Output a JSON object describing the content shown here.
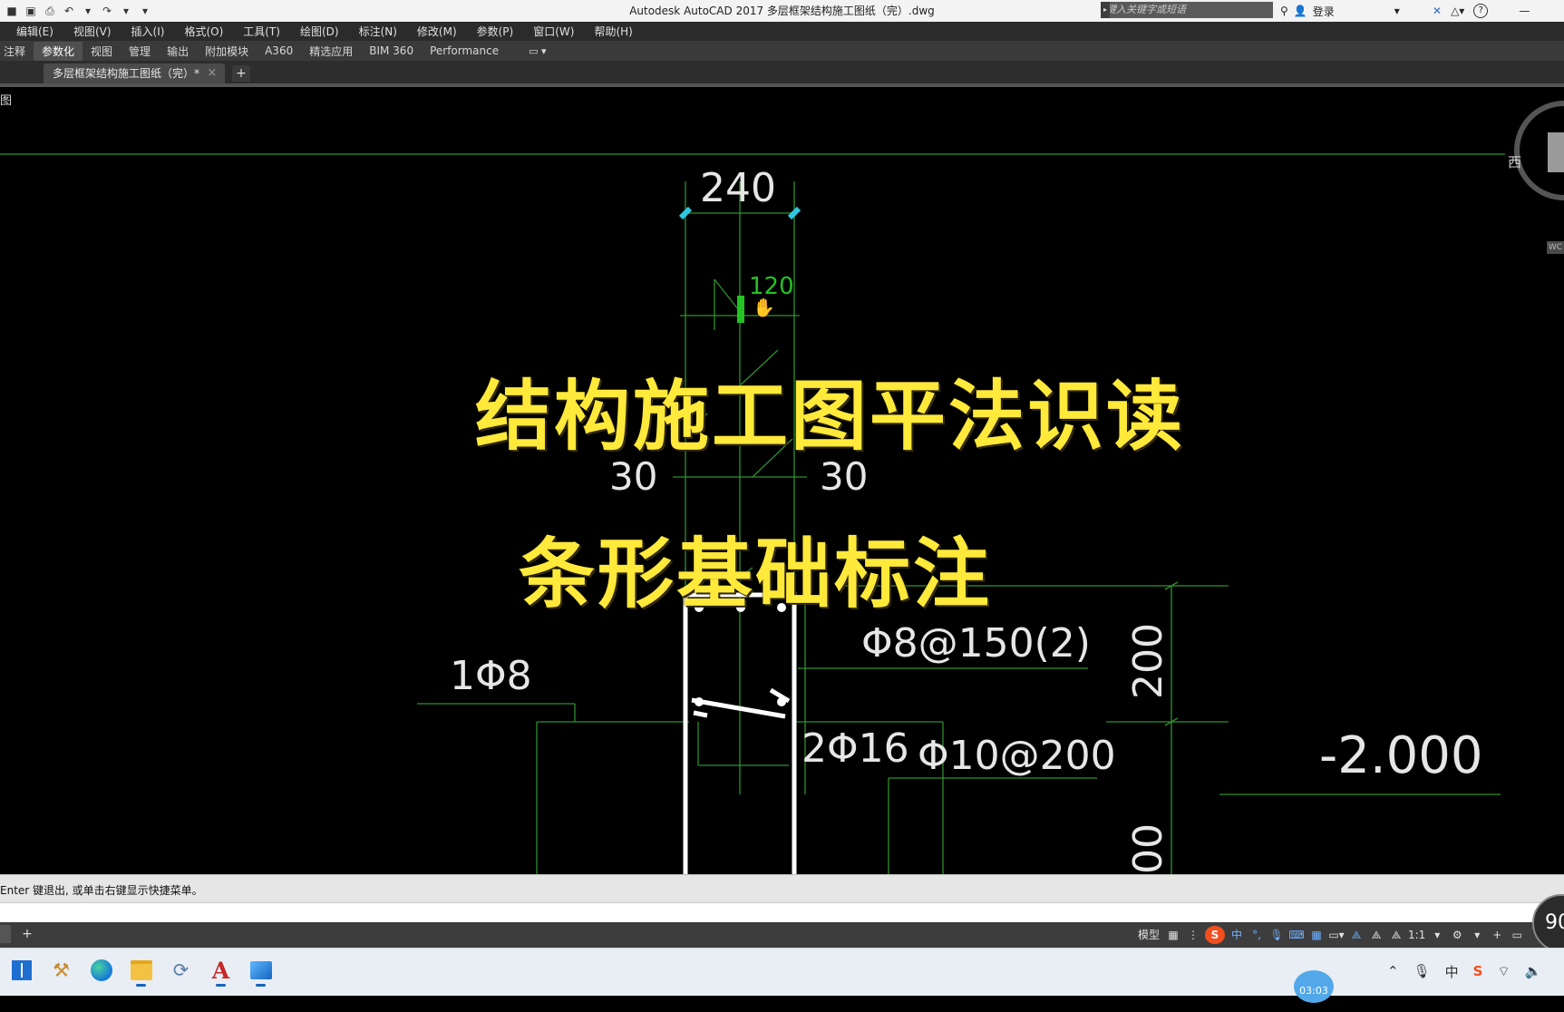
{
  "window": {
    "title": "Autodesk AutoCAD 2017    多层框架结构施工图纸（完）.dwg",
    "search_placeholder": "键入关键字或短语",
    "login_label": "登录",
    "help_label": "?"
  },
  "quick_access": [
    {
      "name": "save-icon",
      "glyph": "■"
    },
    {
      "name": "save-as-icon",
      "glyph": "▣"
    },
    {
      "name": "print-icon",
      "glyph": "⎙"
    },
    {
      "name": "undo-icon",
      "glyph": "↶"
    },
    {
      "name": "undo-dropdown-icon",
      "glyph": "▾"
    },
    {
      "name": "redo-icon",
      "glyph": "↷"
    },
    {
      "name": "redo-dropdown-icon",
      "glyph": "▾"
    },
    {
      "name": "customize-qat-icon",
      "glyph": "▾"
    }
  ],
  "menu": [
    "编辑(E)",
    "视图(V)",
    "插入(I)",
    "格式(O)",
    "工具(T)",
    "绘图(D)",
    "标注(N)",
    "修改(M)",
    "参数(P)",
    "窗口(W)",
    "帮助(H)"
  ],
  "ribbon_tabs": [
    {
      "label": "注释",
      "active": false
    },
    {
      "label": "参数化",
      "active": true
    },
    {
      "label": "视图",
      "active": false
    },
    {
      "label": "管理",
      "active": false
    },
    {
      "label": "输出",
      "active": false
    },
    {
      "label": "附加模块",
      "active": false
    },
    {
      "label": "A360",
      "active": false
    },
    {
      "label": "精选应用",
      "active": false
    },
    {
      "label": "BIM 360",
      "active": false
    },
    {
      "label": "Performance",
      "active": false
    }
  ],
  "ribbon_toggle": "▭ ▾",
  "doc_tab": {
    "label": "多层框架结构施工图纸（完）*",
    "close": "×",
    "new": "+"
  },
  "viewport_label": "图",
  "viewcube": {
    "west_label": "西",
    "wcs_label": "WC"
  },
  "overlay": {
    "title": "结构施工图平法识读",
    "subtitle": "条形基础标注"
  },
  "drawing": {
    "dim_width": "240",
    "dim_left": "30",
    "dim_right": "30",
    "grip_note": "120",
    "rebar_left": "1Φ8",
    "stirrup": "Φ8@150(2)",
    "dim_vertical": "200",
    "rebar_bottom": "2Φ16",
    "distribution": "Φ10@200",
    "dim_vertical_2": "00",
    "elevation": "-2.000"
  },
  "command_line": {
    "history": "Enter 键退出, 或单击右键显示快捷菜单。"
  },
  "status_bar": {
    "model_label": "模型",
    "ime_label": "S",
    "ime_lang": "中",
    "scale_label": "1:1",
    "items": [
      "⚙",
      "+",
      "▭"
    ]
  },
  "overlay_viewer": {
    "label": "90"
  },
  "taskbar": {
    "clock": "03:03",
    "apps": [
      {
        "name": "start-menu",
        "running": false
      },
      {
        "name": "tool-app",
        "running": false
      },
      {
        "name": "edge-browser",
        "running": false
      },
      {
        "name": "file-explorer",
        "running": true
      },
      {
        "name": "sync-app",
        "running": false
      },
      {
        "name": "autocad-app",
        "running": true
      },
      {
        "name": "photos-app",
        "running": true
      }
    ]
  },
  "colors": {
    "drawing_line": "#2f8f2f",
    "drawing_text": "#e6e6e6",
    "overlay_text": "#ffe93a",
    "grip": "#2fc6df"
  }
}
